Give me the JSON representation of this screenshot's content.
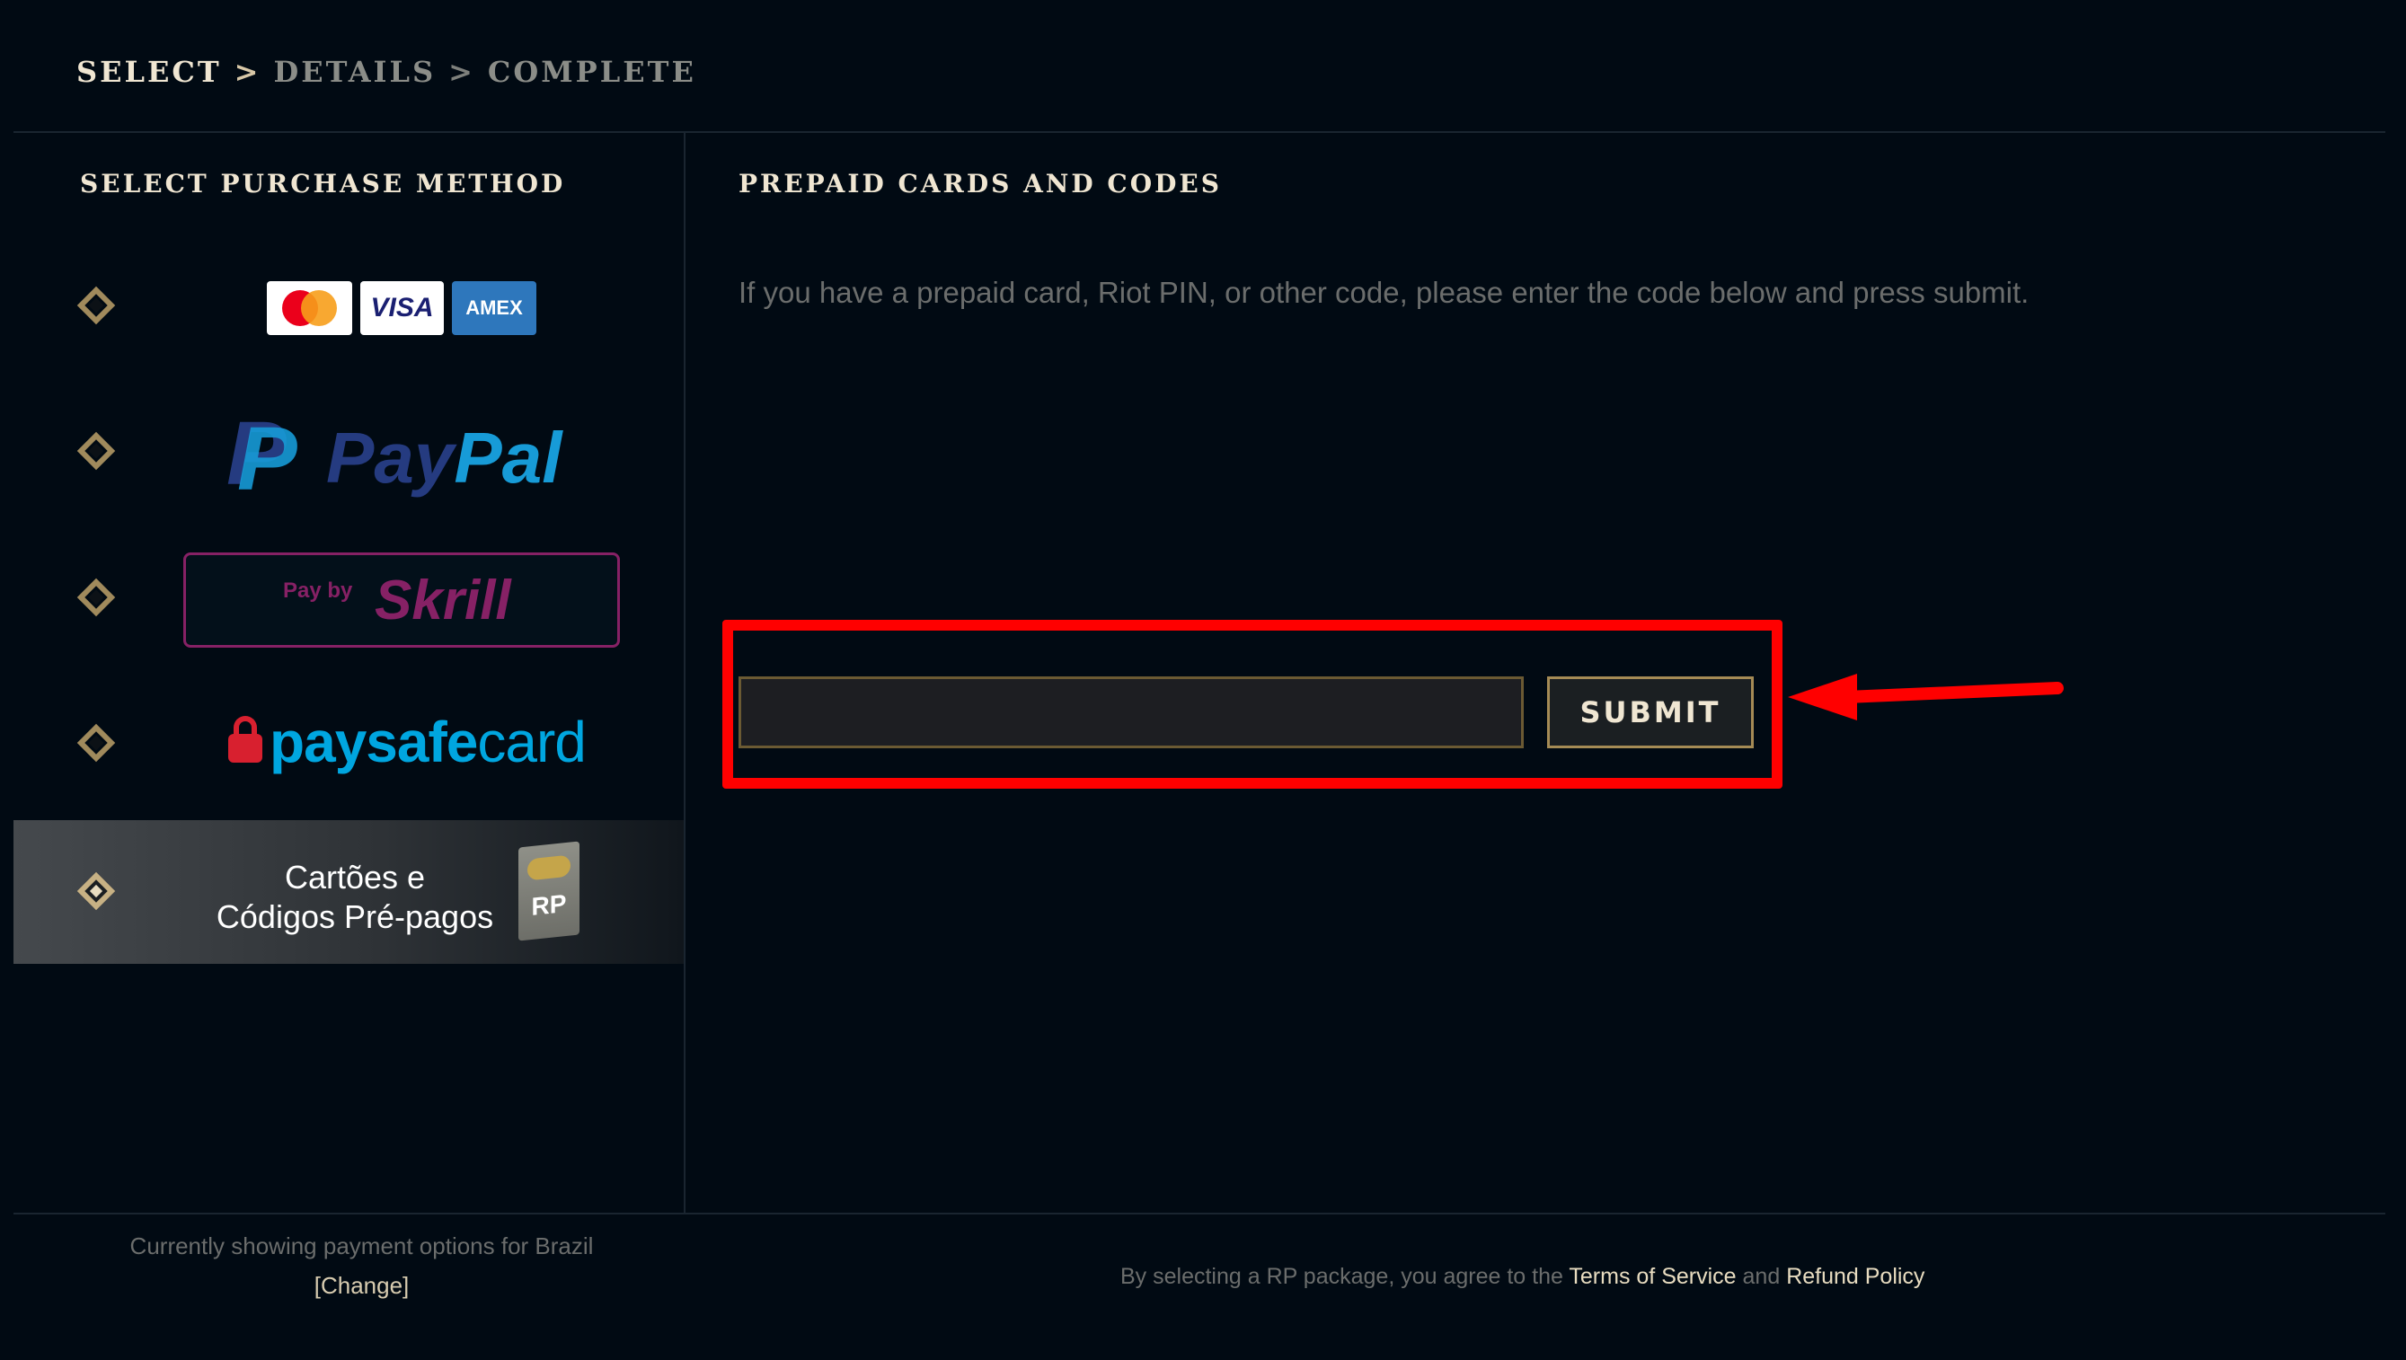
{
  "breadcrumb": {
    "step1": "SELECT",
    "sep1": ">",
    "step2": "DETAILS",
    "sep2": ">",
    "step3": "COMPLETE"
  },
  "left_panel": {
    "title": "SELECT PURCHASE METHOD",
    "methods": [
      {
        "id": "credit-card",
        "logos": [
          "Mastercard",
          "VISA",
          "AMEX"
        ]
      },
      {
        "id": "paypal",
        "logo_text_1": "Pay",
        "logo_text_2": "Pal"
      },
      {
        "id": "skrill",
        "prefix": "Pay by",
        "logo_text": "Skrill"
      },
      {
        "id": "paysafecard",
        "logo_text_1": "paysafe",
        "logo_text_2": "card"
      },
      {
        "id": "prepaid",
        "label_line1": "Cartões e",
        "label_line2": "Códigos Pré-pagos",
        "badge": "RP",
        "selected": true
      }
    ]
  },
  "right_panel": {
    "title": "PREPAID CARDS AND CODES",
    "description": "If you have a prepaid card, Riot PIN, or other code, please enter the code below and press submit.",
    "code_input": {
      "value": "",
      "placeholder": ""
    },
    "submit_label": "SUBMIT"
  },
  "footer": {
    "region_text": "Currently showing payment options for  Brazil",
    "change_label": "[Change]",
    "terms_prefix": "By selecting a RP package, you agree to the ",
    "terms_link": "Terms of Service",
    "terms_and": " and ",
    "refund_link": "Refund Policy"
  },
  "colors": {
    "background": "#010a13",
    "gold": "#c7b184",
    "highlight": "#ff0000",
    "text_light": "#f0e6d2"
  }
}
